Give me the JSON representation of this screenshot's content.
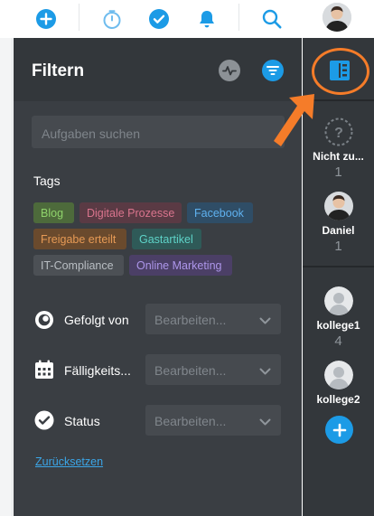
{
  "colors": {
    "accent": "#1c9be6",
    "highlight": "#f57c29",
    "panel_bg": "#3a3e43",
    "sidebar_bg": "#33373b"
  },
  "toolbar": {
    "icons": [
      "plus-circle-icon",
      "stopwatch-icon",
      "checkmark-circle-icon",
      "bell-icon",
      "search-icon",
      "user-avatar"
    ]
  },
  "filter_panel": {
    "title": "Filtern",
    "search_placeholder": "Aufgaben suchen",
    "tags_label": "Tags",
    "tags": [
      {
        "label": "Blog",
        "bg": "#4d6a3b",
        "fg": "#8fd36b"
      },
      {
        "label": "Digitale Prozesse",
        "bg": "#5a3a44",
        "fg": "#d9748d"
      },
      {
        "label": "Facebook",
        "bg": "#2f4d66",
        "fg": "#5fb1ef"
      },
      {
        "label": "Freigabe erteilt",
        "bg": "#6a4a2d",
        "fg": "#e69a55"
      },
      {
        "label": "Gastartikel",
        "bg": "#2f5a58",
        "fg": "#5ed3c8"
      },
      {
        "label": "IT-Compliance",
        "bg": "#4c5055",
        "fg": "#b9bec3"
      },
      {
        "label": "Online Marketing",
        "bg": "#4b3f66",
        "fg": "#ad96ea"
      }
    ],
    "rows": [
      {
        "label": "Gefolgt von",
        "value": "Bearbeiten..."
      },
      {
        "label": "Fälligkeits...",
        "value": "Bearbeiten..."
      },
      {
        "label": "Status",
        "value": "Bearbeiten..."
      }
    ],
    "reset_label": "Zurücksetzen"
  },
  "sidebar": {
    "people": [
      {
        "name": "Nicht zu...",
        "count": "1"
      },
      {
        "name": "Daniel",
        "count": "1"
      },
      {
        "name": "kollege1",
        "count": "4"
      },
      {
        "name": "kollege2",
        "count": ""
      }
    ],
    "add_label": "+"
  }
}
